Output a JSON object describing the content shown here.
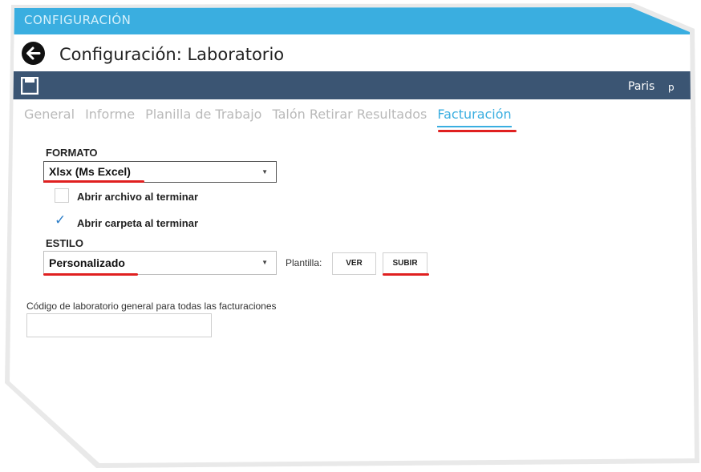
{
  "window": {
    "title": "CONFIGURACIÓN"
  },
  "header": {
    "title": "Configuración: Laboratorio"
  },
  "toolbar": {
    "user_name": "Paris",
    "user_initial": "p"
  },
  "tabs": [
    {
      "label": "General"
    },
    {
      "label": "Informe"
    },
    {
      "label": "Planilla de Trabajo"
    },
    {
      "label": "Talón Retirar Resultados"
    },
    {
      "label": "Facturación"
    }
  ],
  "form": {
    "formato_label": "FORMATO",
    "formato_value": "Xlsx (Ms Excel)",
    "abrir_archivo_label": "Abrir archivo al terminar",
    "abrir_carpeta_label": "Abrir carpeta al terminar",
    "estilo_label": "ESTILO",
    "estilo_value": "Personalizado",
    "plantilla_label": "Plantilla:",
    "ver_label": "VER",
    "subir_label": "SUBIR",
    "codigo_label": "Código de laboratorio general para todas las facturaciones",
    "codigo_value": ""
  },
  "icons": {
    "caret": "▼",
    "check": "✓"
  },
  "colors": {
    "accent": "#3aaee0",
    "toolbar": "#3b5573",
    "annotation": "#e02020"
  }
}
